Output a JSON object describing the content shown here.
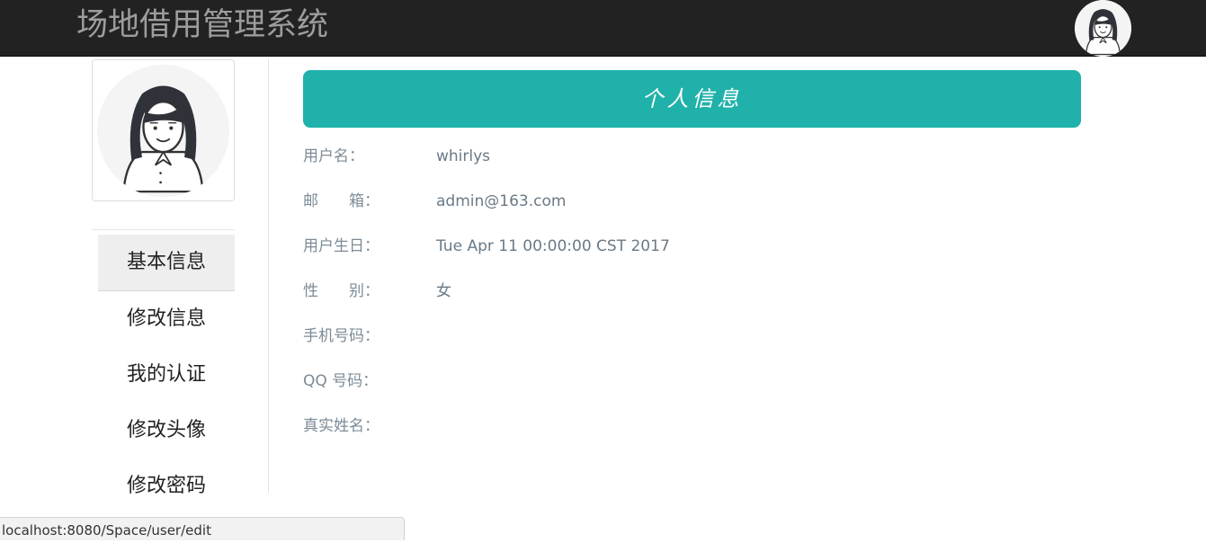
{
  "header": {
    "brand": "场地借用管理系统",
    "avatar_icon": "female-avatar-icon"
  },
  "sidebar": {
    "avatar_icon": "female-avatar-icon",
    "items": [
      {
        "label": "基本信息",
        "active": true
      },
      {
        "label": "修改信息",
        "active": false
      },
      {
        "label": "我的认证",
        "active": false
      },
      {
        "label": "修改头像",
        "active": false
      },
      {
        "label": "修改密码",
        "active": false
      }
    ]
  },
  "main": {
    "panel_title": "个人信息",
    "fields": [
      {
        "label": "用户名：",
        "value": "whirlys"
      },
      {
        "label": "邮　　箱：",
        "value": "admin@163.com"
      },
      {
        "label": "用户生日：",
        "value": "Tue Apr 11 00:00:00 CST 2017"
      },
      {
        "label": "性　　别：",
        "value": "女"
      },
      {
        "label": "手机号码：",
        "value": ""
      },
      {
        "label": "QQ 号码：",
        "value": ""
      },
      {
        "label": "真实姓名：",
        "value": ""
      }
    ]
  },
  "statusbar": {
    "url": "localhost:8080/Space/user/edit"
  },
  "colors": {
    "topbar": "#222222",
    "brand_text": "#9d9d9d",
    "panel_accent": "#20b2aa",
    "active_menu_bg": "#eeeeee"
  }
}
